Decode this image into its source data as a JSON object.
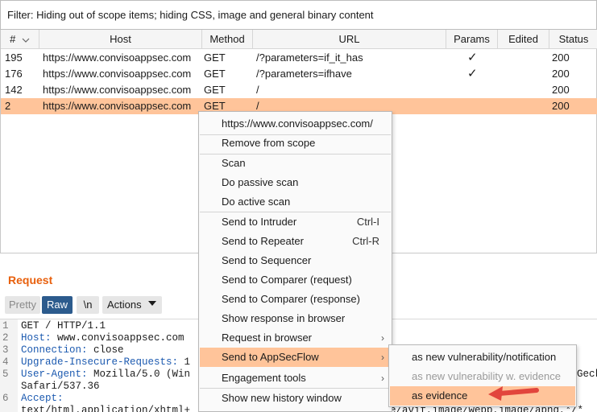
{
  "filter": {
    "text": "Filter: Hiding out of scope items;  hiding CSS, image and general binary content"
  },
  "table": {
    "headers": {
      "num": "#",
      "host": "Host",
      "method": "Method",
      "url": "URL",
      "params": "Params",
      "edited": "Edited",
      "status": "Status"
    },
    "rows": [
      {
        "num": "195",
        "host": "https://www.convisoappsec.com",
        "method": "GET",
        "url": "/?parameters=if_it_has",
        "params": "✓",
        "status": "200"
      },
      {
        "num": "176",
        "host": "https://www.convisoappsec.com",
        "method": "GET",
        "url": "/?parameters=ifhave",
        "params": "✓",
        "status": "200"
      },
      {
        "num": "142",
        "host": "https://www.convisoappsec.com",
        "method": "GET",
        "url": "/",
        "params": "",
        "status": "200"
      },
      {
        "num": "2",
        "host": "https://www.convisoappsec.com",
        "method": "GET",
        "url": "/",
        "params": "",
        "status": "200"
      }
    ]
  },
  "request": {
    "title": "Request",
    "tabs": {
      "pretty": "Pretty",
      "raw": "Raw",
      "newline": "\\n",
      "actions": "Actions"
    },
    "lines": [
      {
        "n": "1",
        "name": "",
        "text": "GET / HTTP/1.1"
      },
      {
        "n": "2",
        "name": "Host:",
        "text": " www.convisoappsec.com"
      },
      {
        "n": "3",
        "name": "Connection:",
        "text": " close"
      },
      {
        "n": "4",
        "name": "Upgrade-Insecure-Requests:",
        "text": " 1"
      },
      {
        "n": "5",
        "name": "User-Agent:",
        "text": " Mozilla/5.0 (Win"
      },
      {
        "n": "",
        "name": "",
        "text": "Safari/537.36"
      },
      {
        "n": "6",
        "name": "Accept:",
        "text": ""
      },
      {
        "n": "",
        "name": "",
        "text": "text/html,application/xhtml+"
      }
    ],
    "overflow_text": "Geck",
    "overflow_text2": "e/avif,image/webp,image/apng,*/*"
  },
  "context_menu": {
    "url_item": "https://www.convisoappsec.com/",
    "remove_scope": "Remove from scope",
    "scan": "Scan",
    "passive_scan": "Do passive scan",
    "active_scan": "Do active scan",
    "send_intruder": "Send to Intruder",
    "send_intruder_sc": "Ctrl-I",
    "send_repeater": "Send to Repeater",
    "send_repeater_sc": "Ctrl-R",
    "send_sequencer": "Send to Sequencer",
    "send_comparer_req": "Send to Comparer (request)",
    "send_comparer_resp": "Send to Comparer (response)",
    "show_response": "Show response in browser",
    "request_browser": "Request in browser",
    "send_appsecflow": "Send to AppSecFlow",
    "engagement_tools": "Engagement tools",
    "show_history": "Show new history window"
  },
  "submenu": {
    "new_vuln": "as new vulnerability/notification",
    "new_vuln_evidence": "as new vulnerability w. evidence",
    "as_evidence": "as evidence"
  },
  "colors": {
    "accent": "#e8600d",
    "selection": "#ffc49a",
    "raw_tab": "#2c5b8d",
    "arrow": "#e2453c"
  }
}
